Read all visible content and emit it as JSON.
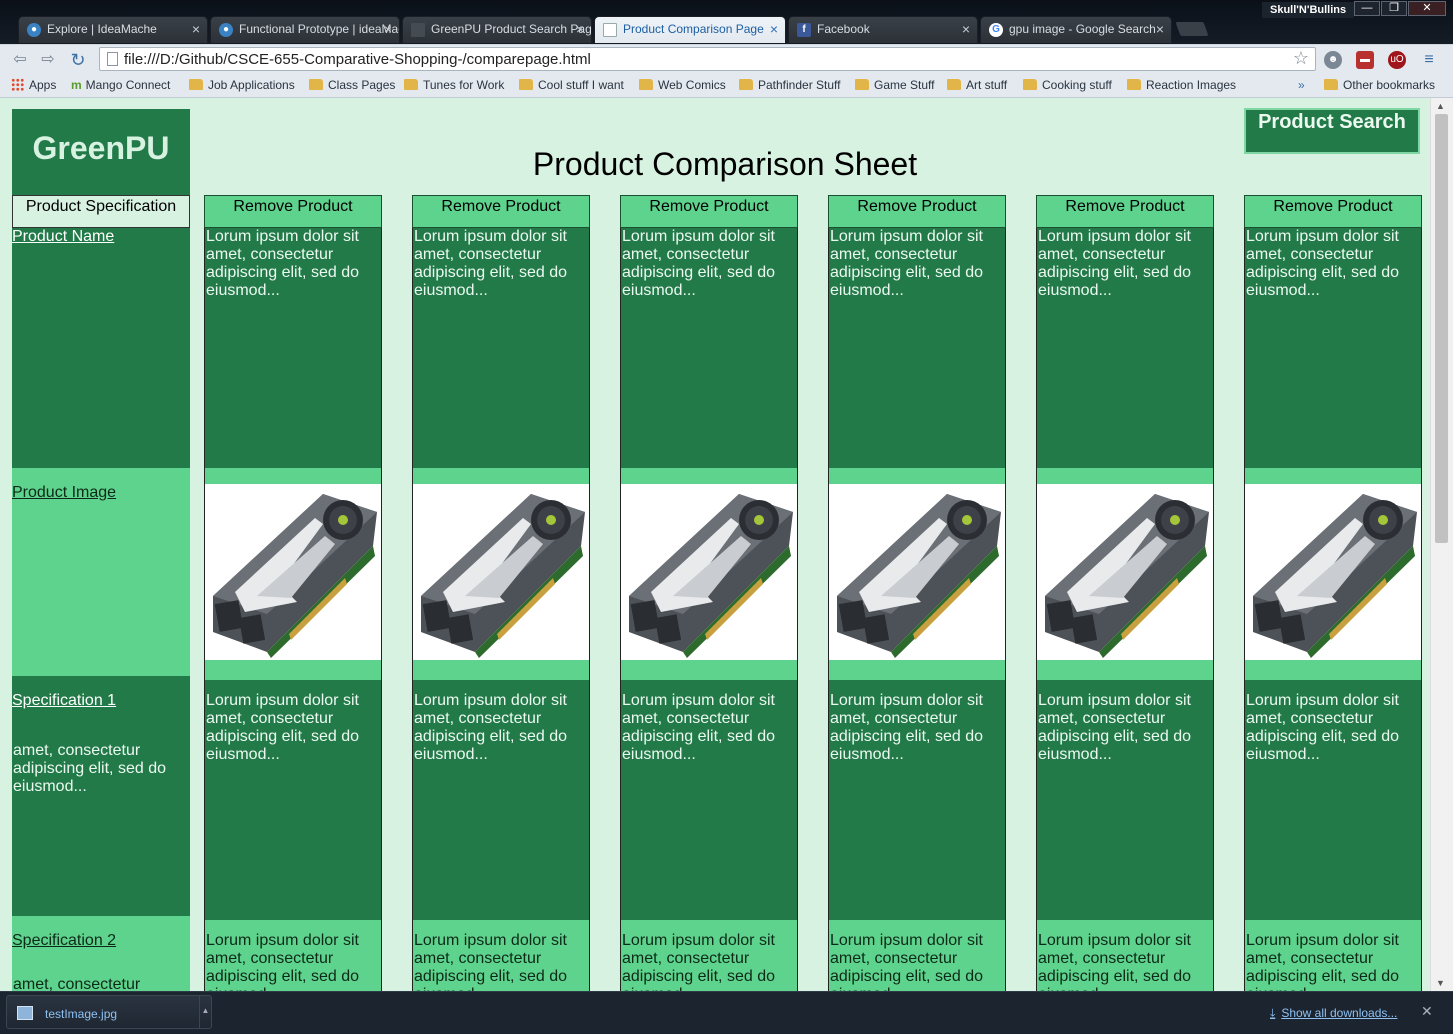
{
  "browser": {
    "tabs": [
      {
        "title": "Explore | IdeaMache",
        "favicon_color": "#3b82c4"
      },
      {
        "title": "Functional Prototype | ideaMache",
        "favicon_color": "#3b82c4"
      },
      {
        "title": "GreenPU Product Search Page",
        "favicon_color": "#444b53"
      },
      {
        "title": "Product Comparison Page",
        "favicon_color": "#e9eef3"
      },
      {
        "title": "Facebook",
        "favicon_color": "#3b5998"
      },
      {
        "title": "gpu image - Google Search",
        "favicon_color": "#ffffff"
      }
    ],
    "profile_name": "Skull'N'Bullins",
    "window_buttons": {
      "minimize": "—",
      "restore": "❐",
      "close": "✕"
    },
    "address": "file:///D:/Github/CSCE-655-Comparative-Shopping-/comparepage.html",
    "bookmarks": [
      {
        "label": "Apps",
        "kind": "apps"
      },
      {
        "label": "Mango Connect",
        "kind": "site"
      },
      {
        "label": "Job Applications",
        "kind": "folder"
      },
      {
        "label": "Class Pages",
        "kind": "folder"
      },
      {
        "label": "Tunes for Work",
        "kind": "folder"
      },
      {
        "label": "Cool stuff I want",
        "kind": "folder"
      },
      {
        "label": "Web Comics",
        "kind": "folder"
      },
      {
        "label": "Pathfinder Stuff",
        "kind": "folder"
      },
      {
        "label": "Game Stuff",
        "kind": "folder"
      },
      {
        "label": "Art stuff",
        "kind": "folder"
      },
      {
        "label": "Cooking stuff",
        "kind": "folder"
      },
      {
        "label": "Reaction Images",
        "kind": "folder"
      }
    ],
    "bookmarks_overflow": "»",
    "other_bookmarks": "Other bookmarks"
  },
  "page": {
    "logo": "GreenPU",
    "title": "Product Comparison Sheet",
    "search_button": "Product Search",
    "spec_header": "Product Specification",
    "row_labels": [
      "Product Name",
      "Product Image",
      "Specification 1",
      "Specification 2"
    ],
    "spec1_label_text": "amet, consectetur adipiscing elit, sed do eiusmod...",
    "spec2_label_text": "amet, consectetur",
    "remove_label": "Remove Product",
    "product_count": 6,
    "cell_text": "Lorum ipsum dolor sit amet, consectetur adipiscing elit, sed do eiusmod...",
    "colors": {
      "dark_green": "#227a48",
      "light_green": "#5ed38d",
      "page_bg": "#d8f2e2"
    }
  },
  "downloads": {
    "file": "testImage.jpg",
    "show_all": "Show all downloads..."
  }
}
